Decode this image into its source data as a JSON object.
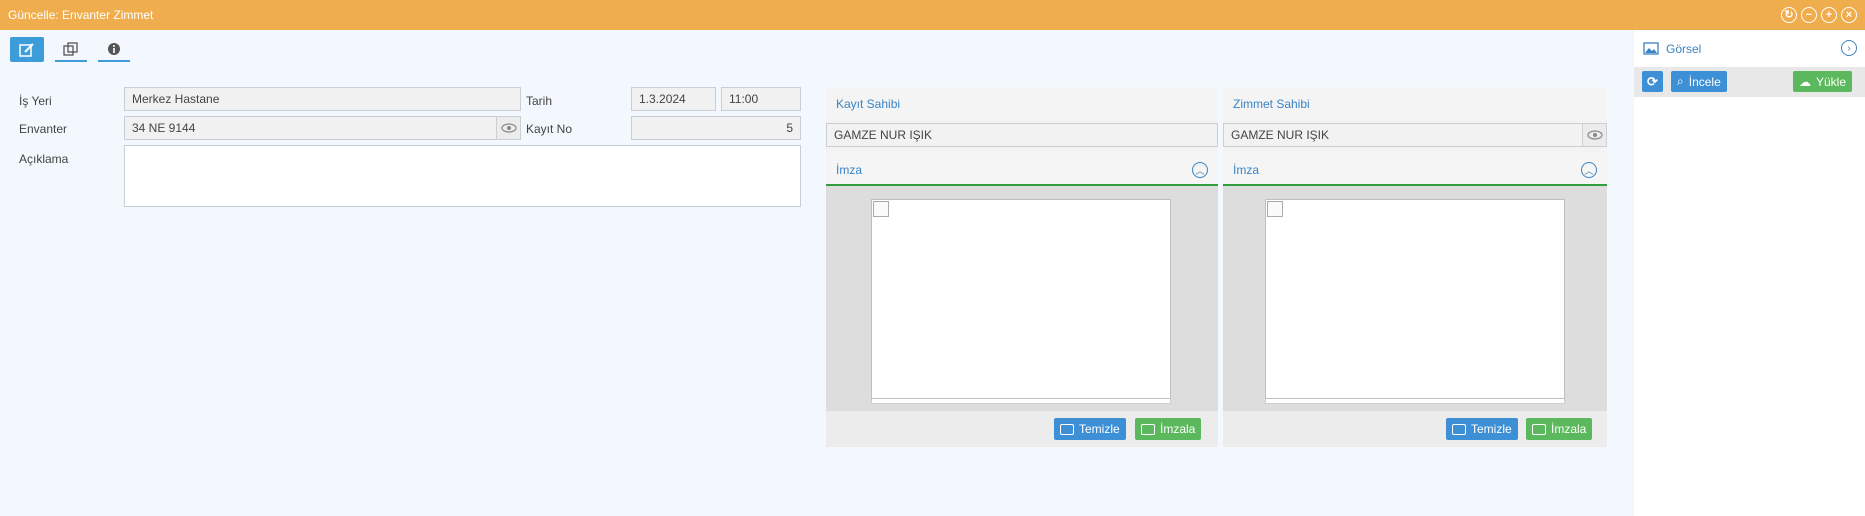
{
  "window": {
    "title": "Güncelle: Envanter Zimmet"
  },
  "form": {
    "is_yeri_label": "İş Yeri",
    "is_yeri_value": "Merkez Hastane",
    "envanter_label": "Envanter",
    "envanter_value": "34 NE 9144",
    "aciklama_label": "Açıklama",
    "aciklama_value": "",
    "tarih_label": "Tarih",
    "tarih_date": "1.3.2024",
    "tarih_time": "11:00",
    "kayit_no_label": "Kayıt No",
    "kayit_no_value": "5"
  },
  "kayit_sahibi": {
    "title": "Kayıt Sahibi",
    "name": "GAMZE NUR IŞIK",
    "signature_title": "İmza",
    "clear_label": "Temizle",
    "sign_label": "İmzala"
  },
  "zimmet_sahibi": {
    "title": "Zimmet Sahibi",
    "name": "GAMZE NUR IŞIK",
    "signature_title": "İmza",
    "clear_label": "Temizle",
    "sign_label": "İmzala"
  },
  "gorsel": {
    "title": "Görsel",
    "inspect_label": "İncele",
    "upload_label": "Yükle"
  },
  "colors": {
    "titlebar": "#f0ad4e",
    "accent_blue": "#3d9ddb",
    "accent_green": "#5cb85c"
  }
}
